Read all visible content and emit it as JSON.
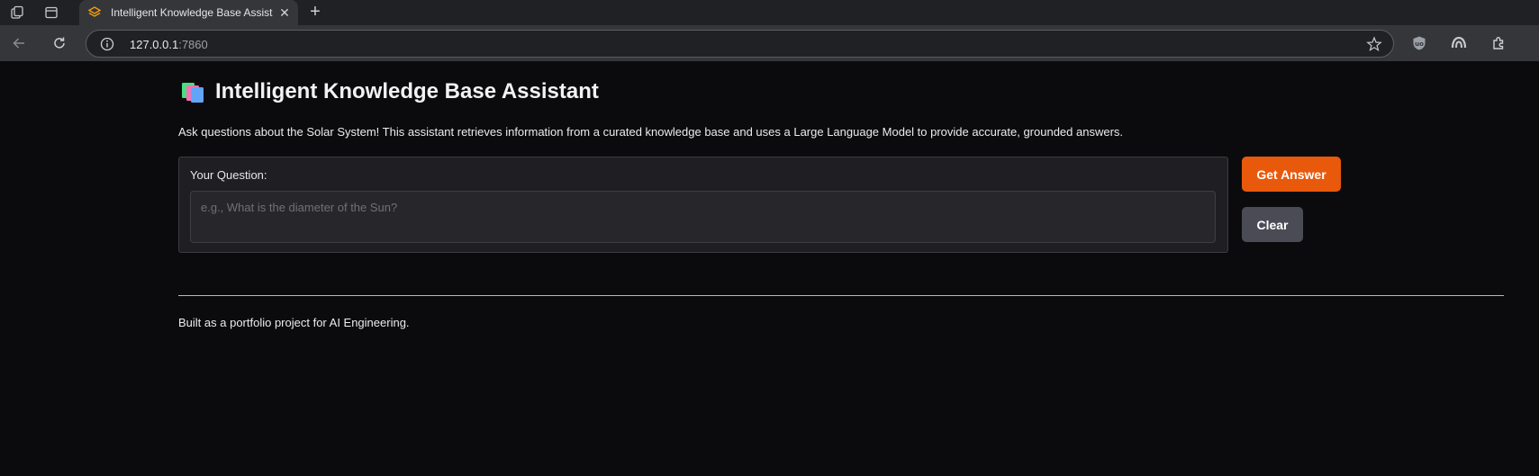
{
  "browser": {
    "tab": {
      "title": "Intelligent Knowledge Base Assist",
      "close_symbol": "✕"
    },
    "new_tab_symbol": "+",
    "address": {
      "host": "127.0.0.1",
      "port": ":7860"
    },
    "icons": [
      "workspaces-icon",
      "tab-actions-icon",
      "favicon-icon",
      "back-icon",
      "reload-icon",
      "info-icon",
      "star-icon",
      "ublock-icon",
      "copilot-icon",
      "extensions-icon"
    ]
  },
  "app": {
    "title": "Intelligent Knowledge Base Assistant",
    "description": "Ask questions about the Solar System! This assistant retrieves information from a curated knowledge base and uses a Large Language Model to provide accurate, grounded answers.",
    "question": {
      "label": "Your Question:",
      "placeholder": "e.g., What is the diameter of the Sun?",
      "value": ""
    },
    "buttons": {
      "submit": "Get Answer",
      "clear": "Clear"
    },
    "footer": "Built as a portfolio project for AI Engineering."
  },
  "colors": {
    "accent": "#e8590c",
    "secondary_button": "#4b4b55",
    "background": "#0b0b0d"
  }
}
